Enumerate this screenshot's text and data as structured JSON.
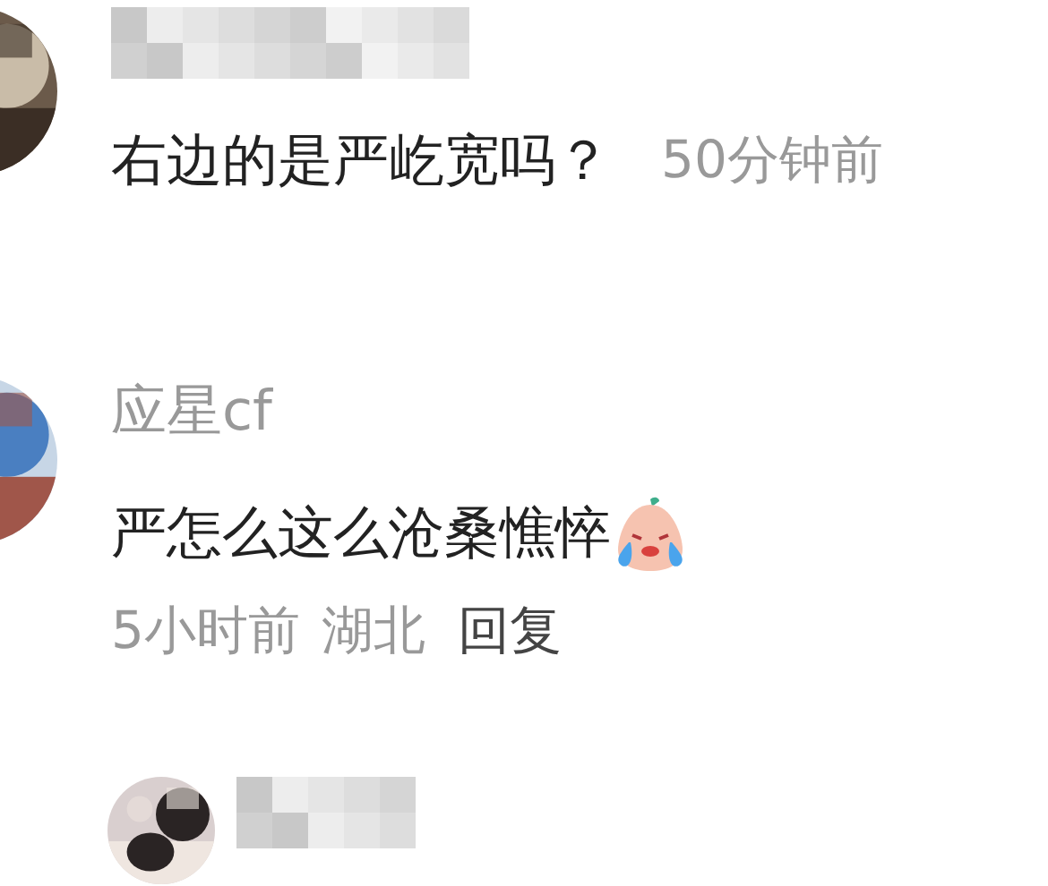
{
  "comments": [
    {
      "kind": "comment",
      "name_hidden": true,
      "text": "右边的是严屹宽吗？",
      "time": "50分钟前"
    },
    {
      "kind": "comment",
      "name_hidden": false,
      "name": "应星cf",
      "text": "严怎么这么沧桑憔悴",
      "emoji": true,
      "meta": [
        "5小时前",
        "湖北"
      ],
      "reply_label": "回复"
    },
    {
      "kind": "reply",
      "name_hidden": true
    }
  ]
}
